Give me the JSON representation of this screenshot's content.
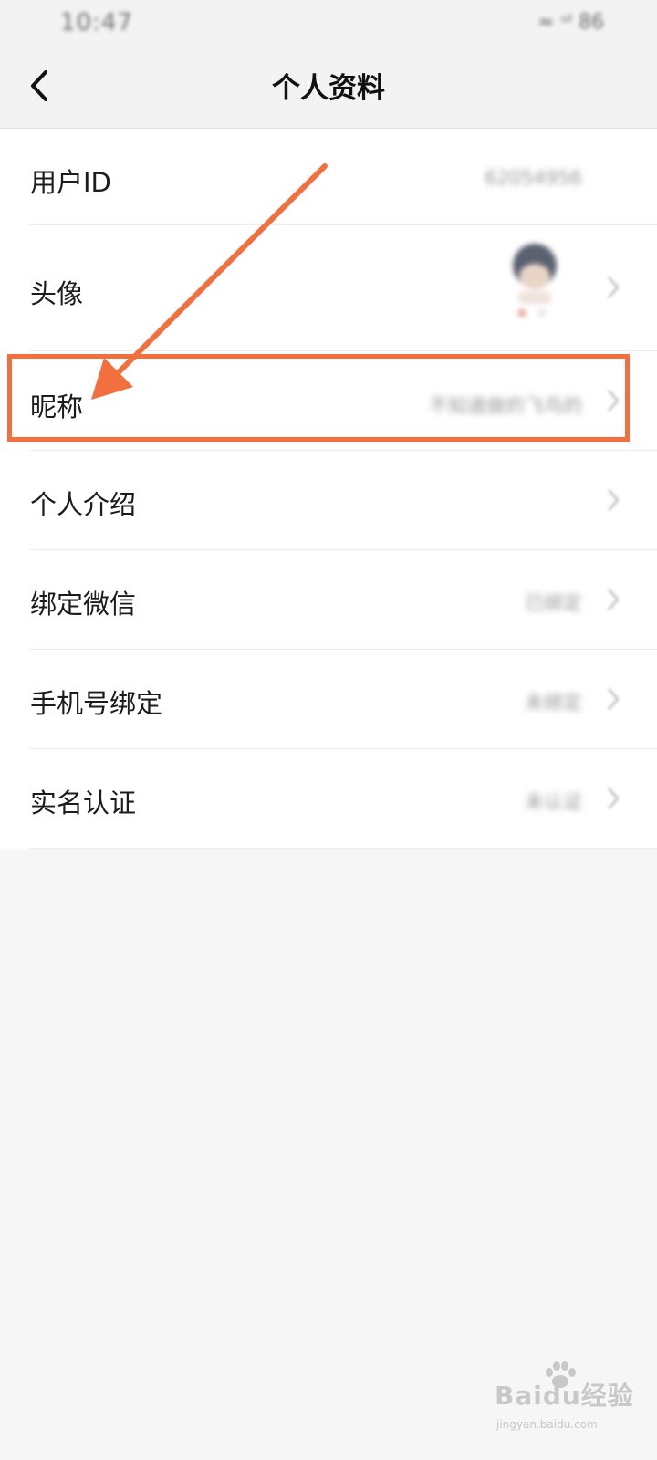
{
  "status_bar": {
    "time": "10:47",
    "icons": "≈ ᵘˡ 86"
  },
  "header": {
    "title": "个人资料",
    "back_icon": "chevron-left-icon"
  },
  "list": {
    "items": [
      {
        "label": "用户ID",
        "value": "62054956"
      },
      {
        "label": "头像",
        "value": ""
      },
      {
        "label": "昵称",
        "value": "不知道做的飞鸟的"
      },
      {
        "label": "个人介绍",
        "value": ""
      },
      {
        "label": "绑定微信",
        "value": "已绑定"
      },
      {
        "label": "手机号绑定",
        "value": "未绑定"
      },
      {
        "label": "实名认证",
        "value": "未认证"
      }
    ]
  },
  "annotation": {
    "color": "#f2703e",
    "highlighted_item": "昵称"
  },
  "watermark": {
    "main": "Baidu经验",
    "sub": "jingyan.baidu.com"
  },
  "colors": {
    "background": "#f6f6f6",
    "list_background": "#ffffff",
    "accent": "#f2703e"
  }
}
